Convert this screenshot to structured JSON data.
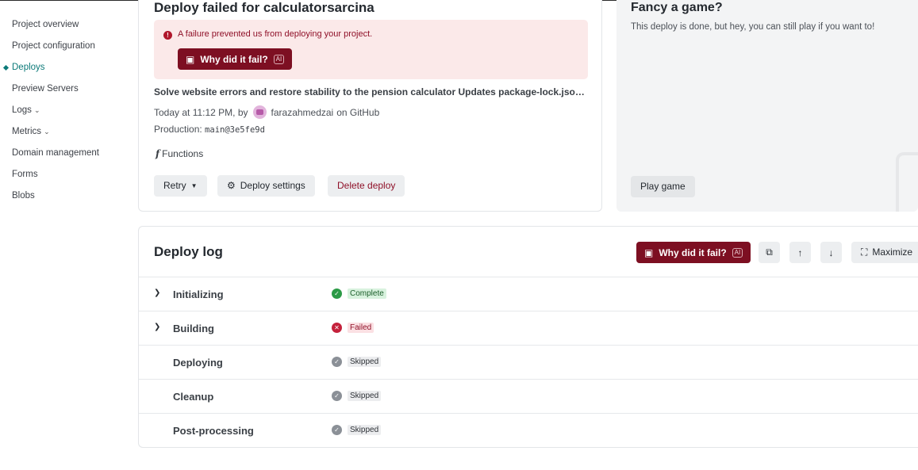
{
  "sidebar": {
    "items": [
      {
        "label": "Project overview"
      },
      {
        "label": "Project configuration"
      },
      {
        "label": "Deploys"
      },
      {
        "label": "Preview Servers"
      },
      {
        "label": "Logs"
      },
      {
        "label": "Metrics"
      },
      {
        "label": "Domain management"
      },
      {
        "label": "Forms"
      },
      {
        "label": "Blobs"
      }
    ]
  },
  "deploy": {
    "title": "Deploy failed for calculatorsarcina",
    "alert_text": "A failure prevented us from deploying your project.",
    "why_label": "Why did it fail?",
    "ai_badge": "AI",
    "commit_message": "Solve website errors and restore stability to the pension calculator Updates package-lock.json dependencies",
    "time_text": "Today at 11:12 PM, by",
    "author": "farazahmedzai",
    "source_text": "on GitHub",
    "production_label": "Production:",
    "production_ref": "main@3e5fe9d",
    "functions_label": "Functions",
    "retry_label": "Retry",
    "settings_label": "Deploy settings",
    "delete_label": "Delete deploy"
  },
  "game": {
    "title": "Fancy a game?",
    "subtitle": "This deploy is done, but hey, you can still play if you want to!",
    "play_label": "Play game"
  },
  "log": {
    "title": "Deploy log",
    "why_label": "Why did it fail?",
    "ai_badge": "AI",
    "maximize_label": "Maximize",
    "rows": [
      {
        "label": "Initializing",
        "status": "Complete",
        "expandable": true
      },
      {
        "label": "Building",
        "status": "Failed",
        "expandable": true
      },
      {
        "label": "Deploying",
        "status": "Skipped",
        "expandable": false
      },
      {
        "label": "Cleanup",
        "status": "Skipped",
        "expandable": false
      },
      {
        "label": "Post-processing",
        "status": "Skipped",
        "expandable": false
      }
    ]
  },
  "colors": {
    "accent_teal": "#0c7a79",
    "danger": "#7d0f22",
    "alert_bg": "#fbe9e9",
    "success": "#2b9a46"
  },
  "icons": [
    "alert-icon",
    "robot-icon",
    "gear-icon",
    "caret-down-icon",
    "copy-icon",
    "arrow-up-icon",
    "arrow-down-icon",
    "maximize-icon",
    "chevron-right-icon",
    "check-circle-icon",
    "x-circle-icon"
  ]
}
